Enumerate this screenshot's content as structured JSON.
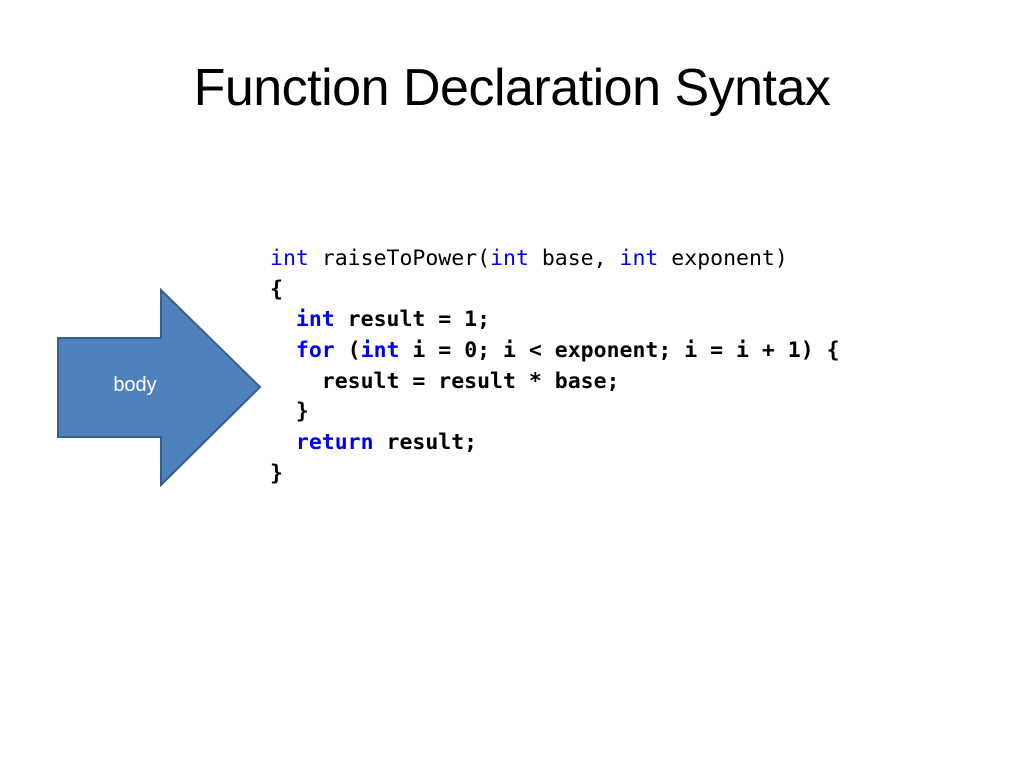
{
  "slide": {
    "title": "Function Declaration Syntax",
    "arrow_label": "body",
    "colors": {
      "arrow_fill": "#4f81bd",
      "arrow_stroke": "#385d8a",
      "keyword": "#0000ff"
    },
    "code": [
      {
        "indent": "",
        "bold": false,
        "tokens": [
          {
            "t": "int",
            "kw": true
          },
          {
            "t": " raiseToPower(",
            "kw": false
          },
          {
            "t": "int",
            "kw": true
          },
          {
            "t": " base, ",
            "kw": false
          },
          {
            "t": "int",
            "kw": true
          },
          {
            "t": " exponent)",
            "kw": false
          }
        ]
      },
      {
        "indent": "",
        "bold": true,
        "tokens": [
          {
            "t": "{",
            "kw": false
          }
        ]
      },
      {
        "indent": "  ",
        "bold": true,
        "tokens": [
          {
            "t": "int",
            "kw": true
          },
          {
            "t": " result = 1;",
            "kw": false
          }
        ]
      },
      {
        "indent": "  ",
        "bold": true,
        "tokens": [
          {
            "t": "for",
            "kw": true
          },
          {
            "t": " (",
            "kw": false
          },
          {
            "t": "int",
            "kw": true
          },
          {
            "t": " i = 0; i < exponent; i = i + 1) {",
            "kw": false
          }
        ]
      },
      {
        "indent": "    ",
        "bold": true,
        "tokens": [
          {
            "t": "result = result * base;",
            "kw": false
          }
        ]
      },
      {
        "indent": "  ",
        "bold": true,
        "tokens": [
          {
            "t": "}",
            "kw": false
          }
        ]
      },
      {
        "indent": "  ",
        "bold": true,
        "tokens": [
          {
            "t": "return",
            "kw": true
          },
          {
            "t": " result;",
            "kw": false
          }
        ]
      },
      {
        "indent": "",
        "bold": true,
        "tokens": [
          {
            "t": "}",
            "kw": false
          }
        ]
      }
    ]
  }
}
